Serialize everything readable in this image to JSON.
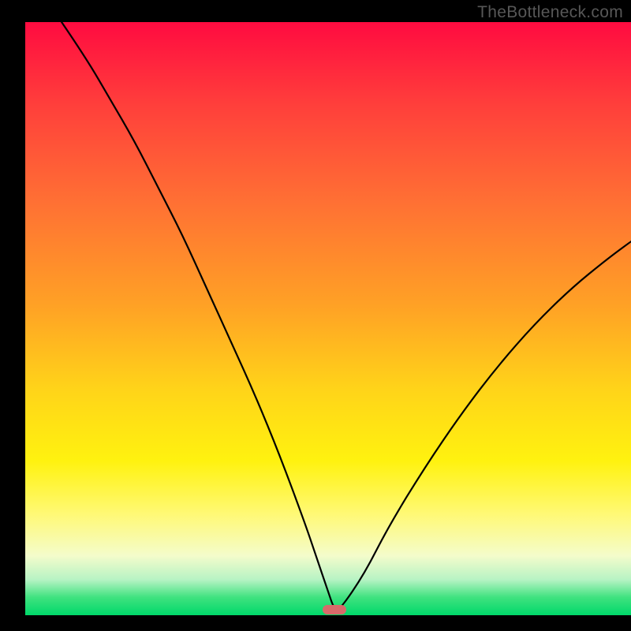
{
  "attribution": "TheBottleneck.com",
  "chart_data": {
    "type": "line",
    "title": "",
    "xlabel": "",
    "ylabel": "",
    "xlim": [
      0,
      100
    ],
    "ylim": [
      0,
      100
    ],
    "series": [
      {
        "name": "bottleneck-curve",
        "x": [
          6,
          10,
          14,
          18,
          22,
          26,
          30,
          34,
          38,
          42,
          46,
          48,
          50,
          51,
          52,
          56,
          60,
          66,
          72,
          78,
          84,
          90,
          96,
          100
        ],
        "values": [
          100,
          94,
          87,
          80,
          72,
          64,
          55,
          46,
          37,
          27,
          16,
          10,
          4,
          1,
          1,
          7,
          15,
          25,
          34,
          42,
          49,
          55,
          60,
          63
        ]
      }
    ],
    "minimum_marker": {
      "x": 51,
      "y": 1
    },
    "colors": {
      "gradient_top": "#ff0b40",
      "gradient_bottom": "#00d86a",
      "curve": "#000000",
      "marker": "#d86a6a"
    }
  }
}
